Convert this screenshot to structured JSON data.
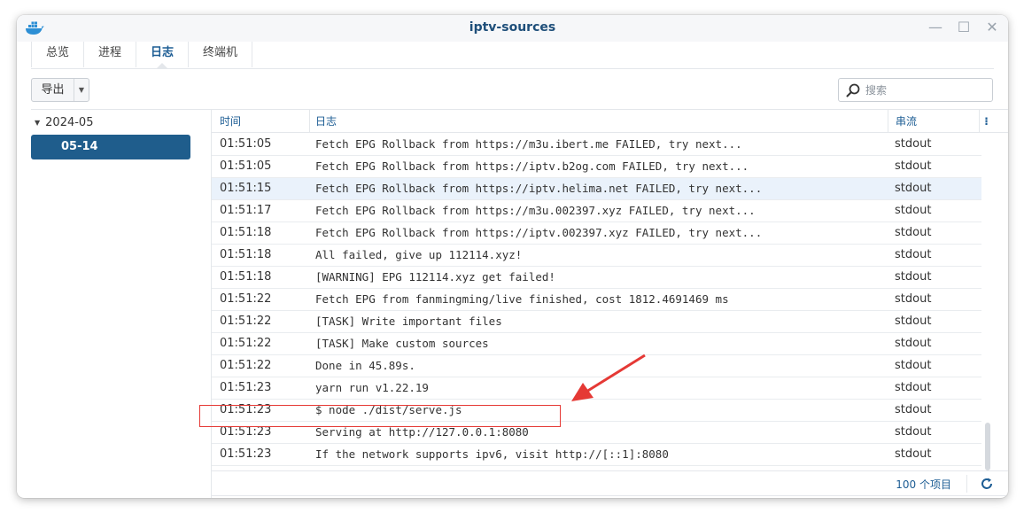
{
  "window": {
    "title": "iptv-sources",
    "controls": [
      "—",
      "☐",
      "✕"
    ]
  },
  "tabs": [
    {
      "label": "总览",
      "active": false
    },
    {
      "label": "进程",
      "active": false
    },
    {
      "label": "日志",
      "active": true
    },
    {
      "label": "终端机",
      "active": false
    }
  ],
  "toolbar": {
    "export_label": "导出",
    "search_placeholder": "搜索"
  },
  "sidebar": {
    "year": "2024-05",
    "selected_date": "05-14"
  },
  "grid": {
    "columns": {
      "time": "时间",
      "log": "日志",
      "stream": "串流",
      "more": "⁝"
    },
    "rows": [
      {
        "time": "01:51:05",
        "message": "Fetch EPG Rollback from https://m3u.ibert.me FAILED, try next...",
        "stream": "stdout"
      },
      {
        "time": "01:51:05",
        "message": "Fetch EPG Rollback from https://iptv.b2og.com FAILED, try next...",
        "stream": "stdout"
      },
      {
        "time": "01:51:15",
        "message": "Fetch EPG Rollback from https://iptv.helima.net FAILED, try next...",
        "stream": "stdout"
      },
      {
        "time": "01:51:17",
        "message": "Fetch EPG Rollback from https://m3u.002397.xyz FAILED, try next...",
        "stream": "stdout"
      },
      {
        "time": "01:51:18",
        "message": "Fetch EPG Rollback from https://iptv.002397.xyz FAILED, try next...",
        "stream": "stdout"
      },
      {
        "time": "01:51:18",
        "message": "All failed, give up 112114.xyz!",
        "stream": "stdout"
      },
      {
        "time": "01:51:18",
        "message": "[WARNING] EPG 112114.xyz get failed!",
        "stream": "stdout"
      },
      {
        "time": "01:51:22",
        "message": "Fetch EPG from fanmingming/live finished, cost 1812.4691469 ms",
        "stream": "stdout"
      },
      {
        "time": "01:51:22",
        "message": "[TASK] Write important files",
        "stream": "stdout"
      },
      {
        "time": "01:51:22",
        "message": "[TASK] Make custom sources",
        "stream": "stdout"
      },
      {
        "time": "01:51:22",
        "message": "Done in 45.89s.",
        "stream": "stdout"
      },
      {
        "time": "01:51:23",
        "message": "yarn run v1.22.19",
        "stream": "stdout"
      },
      {
        "time": "01:51:23",
        "message": "$ node ./dist/serve.js",
        "stream": "stdout"
      },
      {
        "time": "01:51:23",
        "message": "Serving at http://127.0.0.1:8080",
        "stream": "stdout"
      },
      {
        "time": "01:51:23",
        "message": "If the network supports ipv6, visit http://[::1]:8080",
        "stream": "stdout"
      }
    ],
    "highlighted_row": 2,
    "item_count": "100 个项目"
  },
  "colors": {
    "accent": "#1d5d94",
    "selected": "#1f5d8c",
    "annotation": "#e53935",
    "row_highlight": "#eaf2fb"
  }
}
